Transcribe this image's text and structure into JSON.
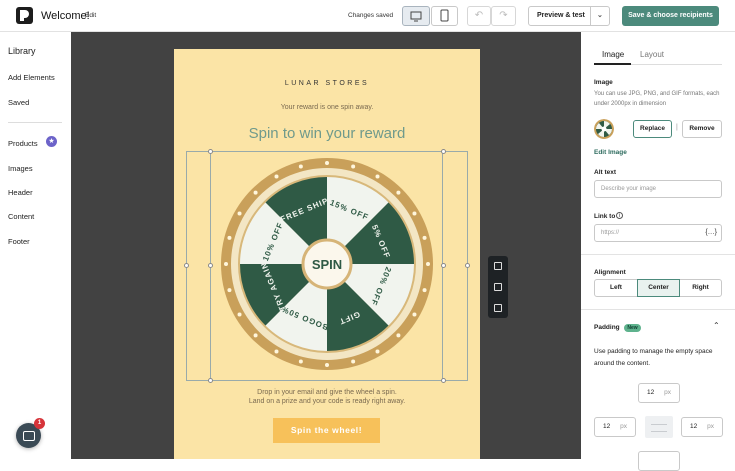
{
  "topbar": {
    "welcome": "Welcome!",
    "edit": "Edit",
    "status": "Changes saved",
    "preview": "Preview & test",
    "save": "Save & choose recipients"
  },
  "sidebar": {
    "library": "Library",
    "items": [
      "Add Elements",
      "Saved",
      "Products",
      "Images",
      "Header",
      "Content",
      "Footer"
    ]
  },
  "chat": {
    "badge": "1"
  },
  "email": {
    "brand": "LUNAR STORES",
    "reward_line": "Your reward is one spin away.",
    "headline": "Spin to win your reward",
    "wheel_center": "SPIN",
    "wheel_segments": [
      "15% OFF",
      "5% OFF",
      "20% OFF",
      "GIFT",
      "BOGO 50%",
      "TRY AGAIN",
      "10% OFF",
      "FREE SHIP"
    ],
    "desc_line1": "Drop in your email and give the wheel a spin.",
    "desc_line2": "Land on a prize and your code is ready right away.",
    "cta": "Spin the wheel!"
  },
  "panel": {
    "tabs": [
      "Image",
      "Layout"
    ],
    "image_title": "Image",
    "image_hint": "You can use JPG, PNG, and GIF formats, each under 2000px in dimension",
    "replace": "Replace",
    "remove": "Remove",
    "edit_image": "Edit Image",
    "alt_label": "Alt text",
    "alt_placeholder": "Describe your image",
    "link_label": "Link to",
    "link_placeholder": "https://",
    "alignment_label": "Alignment",
    "align_options": [
      "Left",
      "Center",
      "Right"
    ],
    "align_selected": "Center",
    "padding_label": "Padding",
    "new_badge": "New",
    "padding_hint": "Use padding to manage the empty space around the content.",
    "padding_top": "12",
    "padding_left": "12",
    "padding_right": "12",
    "unit": "px"
  },
  "colors": {
    "accent": "#4c8a7c",
    "wheel_dark": "#2f5a45",
    "wheel_light": "#f1f4ee",
    "wheel_rim": "#c9a05a",
    "email_bg": "#fbe4a6"
  }
}
